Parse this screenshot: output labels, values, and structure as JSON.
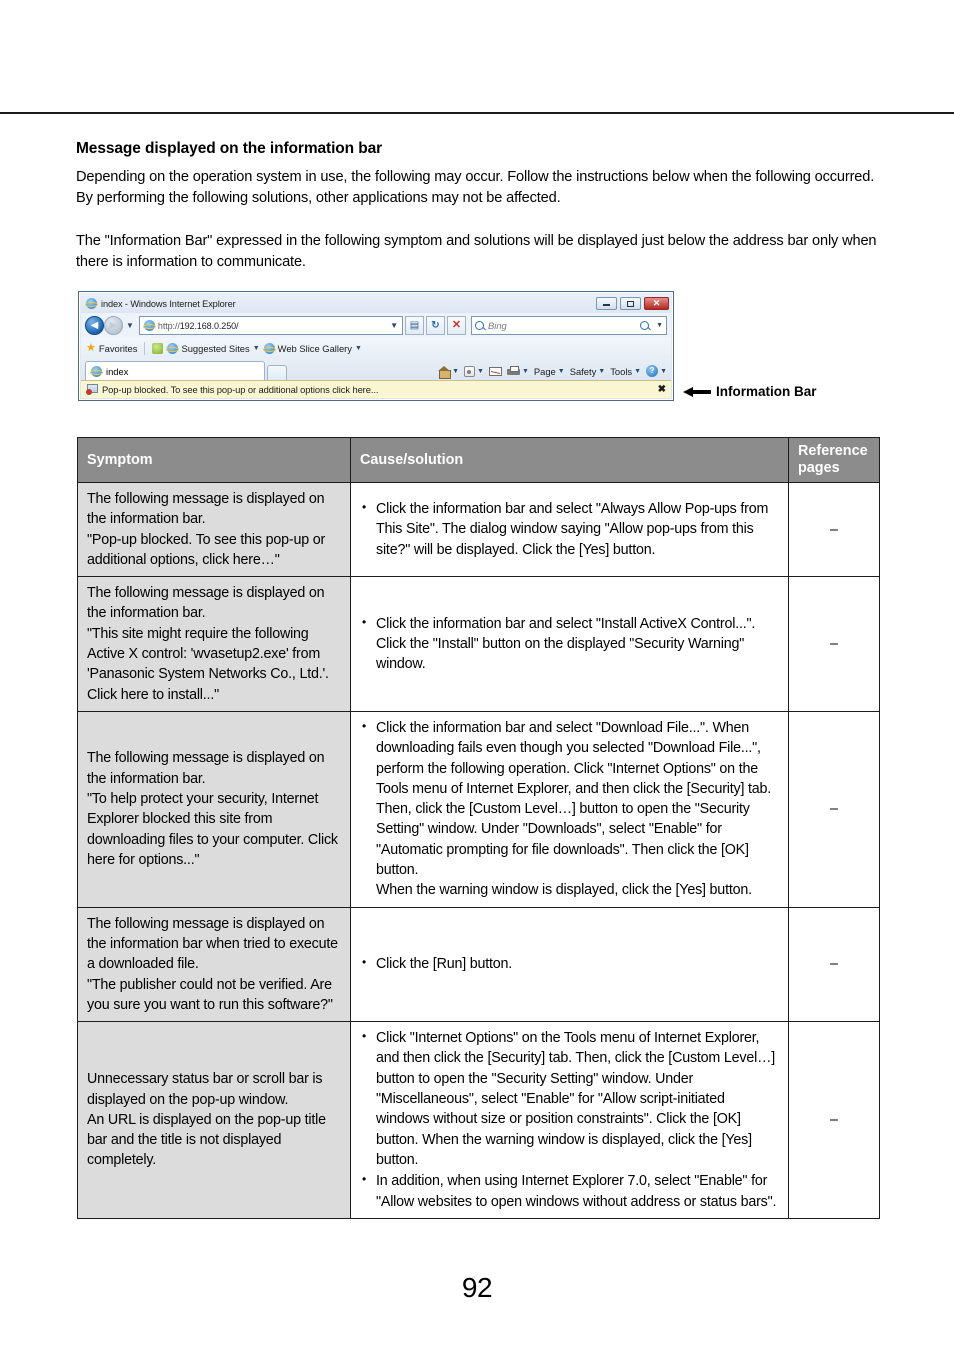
{
  "page": {
    "number": "92"
  },
  "section": {
    "title": "Message displayed on the information bar",
    "paragraph1": "Depending on the operation system in use, the following may occur. Follow the instructions below when the following occurred. By performing the following solutions, other applications may not be affected.",
    "paragraph2": "The \"Information Bar\" expressed in the following symptom and solutions will be displayed just below the address bar only when there is information to communicate."
  },
  "browser": {
    "window_title": "index - Windows Internet Explorer",
    "address_url_prefix": "http://",
    "address_url_host": "192.168.0.250/",
    "search_placeholder": "Bing",
    "favorites_label": "Favorites",
    "suggested_sites_label": "Suggested Sites",
    "web_slice_label": "Web Slice Gallery",
    "tab_label": "index",
    "command_bar": [
      "Page",
      "Safety",
      "Tools"
    ],
    "information_bar_text": "Pop-up blocked. To see this pop-up or additional options click here...",
    "information_bar_close": "✖",
    "minimize_glyph": "–",
    "maximize_glyph": "□",
    "close_glyph": "✕"
  },
  "callout": {
    "label": "Information Bar"
  },
  "table": {
    "headers": {
      "symptom": "Symptom",
      "cause": "Cause/solution",
      "reference_line1": "Reference",
      "reference_line2": "pages"
    },
    "rows": [
      {
        "symptom": "The following message is displayed on the information bar.\n\"Pop-up blocked. To see this pop-up or additional options, click here…\"",
        "solutions": [
          "Click the information bar and select \"Always Allow Pop-ups from This Site\". The dialog window saying \"Allow pop-ups from this site?\" will be displayed. Click the [Yes] button."
        ],
        "reference": "–"
      },
      {
        "symptom": "The following message is displayed on the information bar.\n\"This site might require the following Active X control: 'wvasetup2.exe' from 'Panasonic System Networks Co., Ltd.'. Click here to install...\"",
        "solutions": [
          "Click the information bar and select \"Install ActiveX Control...\".\nClick the \"Install\" button on the displayed \"Security Warning\" window."
        ],
        "reference": "–"
      },
      {
        "symptom": "The following message is displayed on the information bar.\n\"To help protect your security, Internet Explorer blocked this site from downloading files to your computer. Click here for options...\"",
        "solutions": [
          "Click the information bar and select \"Download File...\". When downloading fails even though you selected \"Download File...\", perform the following operation. Click \"Internet Options\" on the Tools menu of Internet Explorer, and then click the [Security] tab. Then, click the [Custom Level…] button to open the \"Security Setting\" window. Under \"Downloads\", select \"Enable\" for \"Automatic prompting for file downloads\". Then click the [OK] button.\nWhen the warning window is displayed, click the [Yes] button."
        ],
        "reference": "–"
      },
      {
        "symptom": "The following message is displayed on the information bar when tried to execute a downloaded file.\n\"The publisher could not be verified. Are you sure you want to run this software?\"",
        "solutions": [
          "Click the [Run] button."
        ],
        "reference": "–"
      },
      {
        "symptom": "Unnecessary status bar or scroll bar is displayed on the pop-up window.\nAn URL is displayed on the pop-up title bar and the title is not displayed completely.",
        "solutions": [
          "Click \"Internet Options\" on the Tools menu of Internet Explorer, and then click the [Security] tab. Then, click the [Custom Level…] button to open the \"Security Setting\" window. Under \"Miscellaneous\", select \"Enable\" for \"Allow script-initiated windows without size or position constraints\". Click the [OK] button. When the warning window is displayed, click the [Yes] button.",
          "In addition, when using Internet Explorer 7.0, select \"Enable\" for \"Allow websites to open windows without address or status bars\"."
        ],
        "reference": "–"
      }
    ]
  },
  "colors": {
    "table_header_bg": "#8c8c8c",
    "symptom_cell_bg": "#dcdcdc",
    "info_bar_bg": "#fbf6d2",
    "close_button": "#b12a22"
  }
}
